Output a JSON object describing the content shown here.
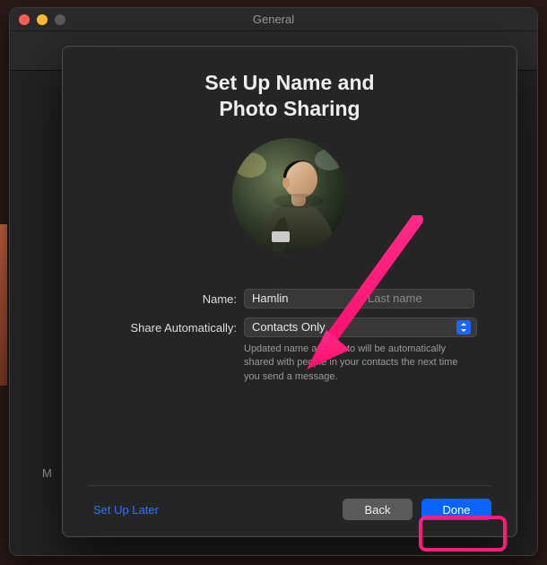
{
  "window": {
    "title": "General"
  },
  "sheet": {
    "heading_line1": "Set Up Name and",
    "heading_line2": "Photo Sharing",
    "name": {
      "label": "Name:",
      "first_value": "Hamlin",
      "last_placeholder": "Last name"
    },
    "share": {
      "label": "Share Automatically:",
      "selected": "Contacts Only",
      "helper": "Updated name and photo will be automatically shared with people in your contacts the next time you send a message."
    },
    "footer": {
      "setup_later": "Set Up Later",
      "back": "Back",
      "done": "Done"
    }
  },
  "background": {
    "prefs_sidebar_letter": "M"
  },
  "colors": {
    "accent": "#0a63ff",
    "annotation": "#ff1d7a"
  }
}
